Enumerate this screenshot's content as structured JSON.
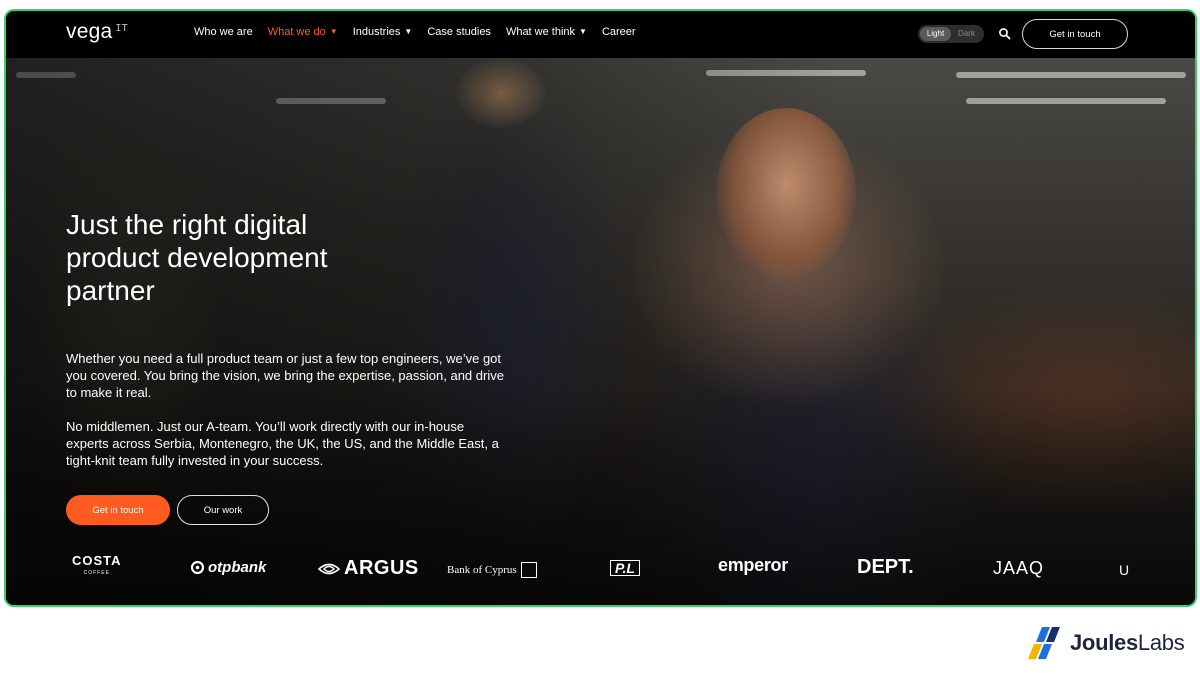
{
  "site": {
    "logo_text": "vega",
    "logo_sup": "IT"
  },
  "nav": {
    "items": [
      {
        "label": "Who we are",
        "dropdown": false,
        "active": false
      },
      {
        "label": "What we do",
        "dropdown": true,
        "active": true
      },
      {
        "label": "Industries",
        "dropdown": true,
        "active": false
      },
      {
        "label": "Case studies",
        "dropdown": false,
        "active": false
      },
      {
        "label": "What we think",
        "dropdown": true,
        "active": false
      },
      {
        "label": "Career",
        "dropdown": false,
        "active": false
      }
    ],
    "theme": {
      "light": "Light",
      "dark": "Dark",
      "selected": "Light"
    },
    "search_icon": "search-icon",
    "cta": "Get in touch"
  },
  "hero": {
    "title": "Just the right digital product development partner",
    "paragraph1": "Whether you need a full product team or just a few top engineers, we’ve got you covered. You bring the vision, we bring the expertise, passion, and drive to make it real.",
    "paragraph2": "No middlemen. Just our A-team. You’ll work directly with our in-house experts across Serbia, Montenegro, the UK, the US, and the Middle East, a tight-knit team fully invested in your success.",
    "primary_button": "Get in touch",
    "secondary_button": "Our work"
  },
  "clients": {
    "costa": "COSTA",
    "costa_sub": "COFFEE",
    "otp": "otpbank",
    "argus": "ARGUS",
    "cyprus": "Bank of Cyprus",
    "pl": "P.L",
    "emperor": "emperor",
    "dept": "DEPT.",
    "jaaq": "JAAQ",
    "partial": "U"
  },
  "watermark": {
    "brand_a": "Joules",
    "brand_b": "Labs"
  },
  "colors": {
    "accent": "#ff5a1f",
    "frame": "#2fd46a",
    "nav_bg": "#000000"
  }
}
